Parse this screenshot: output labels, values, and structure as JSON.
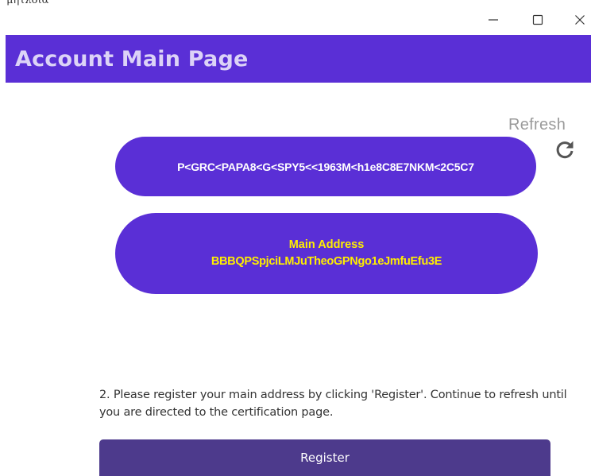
{
  "window": {
    "app_name": "μητλοιά"
  },
  "header": {
    "title": "Account Main Page"
  },
  "refresh": {
    "label": "Refresh"
  },
  "mrz": {
    "text": "P<GRC<PAPA8<G<SPY5<<1963M<h1e8C8E7NKM<2C5C7"
  },
  "address": {
    "label": "Main Address",
    "value": "BBBQPSpjciLMJuTheoGPNgo1eJmfuEfu3E"
  },
  "instructions": {
    "text": "2. Please register your main address by clicking 'Register'. Continue to refresh until you are directed to the certification page."
  },
  "register": {
    "label": "Register"
  },
  "colors": {
    "header_bg": "#5a2fd6",
    "pill_bg": "#5a2fd6",
    "address_text": "#ffee00",
    "register_bg": "#4d3a8c"
  }
}
